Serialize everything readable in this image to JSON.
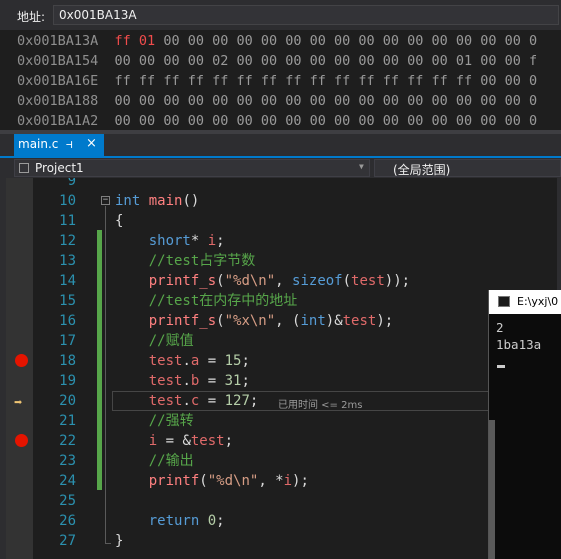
{
  "memory": {
    "address_label": "地址:",
    "address_value": "0x001BA13A",
    "rows": [
      {
        "addr": "0x001BA13A",
        "changed": "ff 01",
        "bytes": " 00 00 00 00 00 00 00 00 00 00 00 00 00 00 00 0"
      },
      {
        "addr": "0x001BA154",
        "changed": "",
        "bytes": "00 00 00 00 02 00 00 00 00 00 00 00 00 00 01 00 00 f"
      },
      {
        "addr": "0x001BA16E",
        "changed": "",
        "bytes": "ff ff ff ff ff ff ff ff ff ff ff ff ff ff ff 00 00 0"
      },
      {
        "addr": "0x001BA188",
        "changed": "",
        "bytes": "00 00 00 00 00 00 00 00 00 00 00 00 00 00 00 00 00 0"
      },
      {
        "addr": "0x001BA1A2",
        "changed": "",
        "bytes": "00 00 00 00 00 00 00 00 00 00 00 00 00 00 00 00 00 0"
      }
    ]
  },
  "tab": {
    "label": "main.c",
    "pin": "⊣",
    "close": "×"
  },
  "nav": {
    "project": "Project1",
    "scope": "(全局范围)"
  },
  "editor": {
    "line_numbers": [
      "9",
      "10",
      "11",
      "12",
      "13",
      "14",
      "15",
      "16",
      "17",
      "18",
      "19",
      "20",
      "21",
      "22",
      "23",
      "24",
      "25",
      "26",
      "27"
    ],
    "perf_tip": "已用时间 <= 2ms"
  },
  "console": {
    "title": "E:\\yxj\\0",
    "lines": [
      "2",
      "1ba13a"
    ]
  },
  "colors": {
    "accent": "#007acc",
    "breakpoint": "#e51400",
    "comment": "#57a64a"
  }
}
